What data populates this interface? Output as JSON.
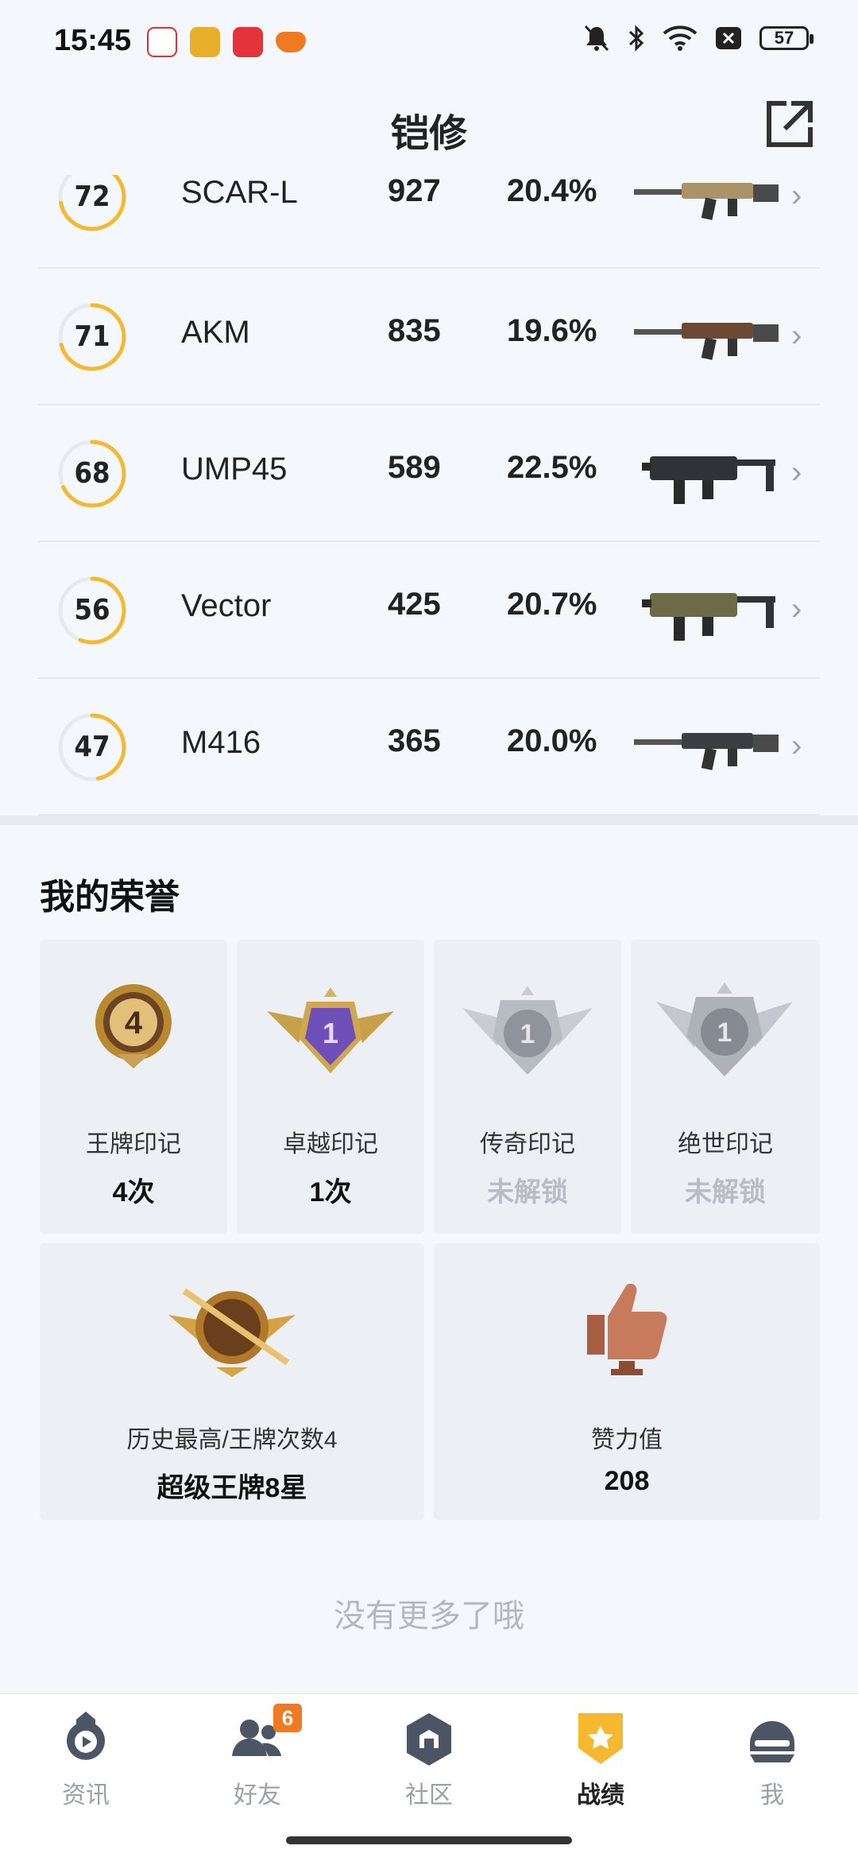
{
  "status": {
    "time": "15:45",
    "battery": "57"
  },
  "header": {
    "title": "铠修"
  },
  "weapons": [
    {
      "score": "72",
      "progress": 0.72,
      "name": "SCAR-L",
      "count": "927",
      "pct": "20.4%",
      "gun_icon": "rifle-icon"
    },
    {
      "score": "71",
      "progress": 0.71,
      "name": "AKM",
      "count": "835",
      "pct": "19.6%",
      "gun_icon": "rifle-icon"
    },
    {
      "score": "68",
      "progress": 0.68,
      "name": "UMP45",
      "count": "589",
      "pct": "22.5%",
      "gun_icon": "smg-icon"
    },
    {
      "score": "56",
      "progress": 0.56,
      "name": "Vector",
      "count": "425",
      "pct": "20.7%",
      "gun_icon": "smg-icon"
    },
    {
      "score": "47",
      "progress": 0.47,
      "name": "M416",
      "count": "365",
      "pct": "20.0%",
      "gun_icon": "rifle-icon"
    }
  ],
  "honors": {
    "title": "我的荣誉",
    "marks": [
      {
        "label": "王牌印记",
        "value": "4次",
        "medal_number": "4",
        "locked": false
      },
      {
        "label": "卓越印记",
        "value": "1次",
        "medal_number": "1",
        "locked": false
      },
      {
        "label": "传奇印记",
        "value": "未解锁",
        "medal_number": "1",
        "locked": true
      },
      {
        "label": "绝世印记",
        "value": "未解锁",
        "medal_number": "1",
        "locked": true
      }
    ],
    "highest": {
      "label": "历史最高/王牌次数4",
      "value": "超级王牌8星"
    },
    "likes": {
      "label": "赞力值",
      "value": "208"
    }
  },
  "footer_note": "没有更多了哦",
  "nav": {
    "items": [
      {
        "label": "资讯",
        "icon": "news-icon",
        "active": false
      },
      {
        "label": "好友",
        "icon": "friends-icon",
        "active": false,
        "badge": "6"
      },
      {
        "label": "社区",
        "icon": "community-icon",
        "active": false
      },
      {
        "label": "战绩",
        "icon": "record-icon",
        "active": true
      },
      {
        "label": "我",
        "icon": "helmet-icon",
        "active": false
      }
    ]
  },
  "colors": {
    "accent": "#f5b82e",
    "ring_track": "#e6e9ee",
    "badge": "#f07a22"
  }
}
